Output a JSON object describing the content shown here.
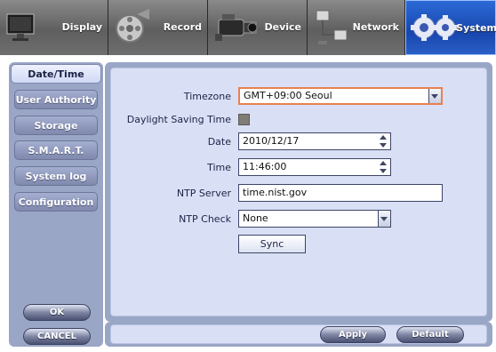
{
  "tabs": [
    {
      "label": "Display",
      "icon": "monitor-icon"
    },
    {
      "label": "Record",
      "icon": "film-reel-icon"
    },
    {
      "label": "Device",
      "icon": "camcorder-icon"
    },
    {
      "label": "Network",
      "icon": "network-icon"
    },
    {
      "label": "System",
      "icon": "gears-icon",
      "active": true
    }
  ],
  "sidebar": {
    "items": [
      {
        "label": "Date/Time",
        "active": true
      },
      {
        "label": "User Authority"
      },
      {
        "label": "Storage"
      },
      {
        "label": "S.M.A.R.T."
      },
      {
        "label": "System log"
      },
      {
        "label": "Configuration"
      }
    ],
    "ok_label": "OK",
    "cancel_label": "CANCEL"
  },
  "form": {
    "timezone": {
      "label": "Timezone",
      "value": "GMT+09:00 Seoul"
    },
    "dst": {
      "label": "Daylight Saving Time",
      "checked": false
    },
    "date": {
      "label": "Date",
      "value": "2010/12/17"
    },
    "time": {
      "label": "Time",
      "value": "11:46:00"
    },
    "ntp_server": {
      "label": "NTP Server",
      "value": "time.nist.gov"
    },
    "ntp_check": {
      "label": "NTP Check",
      "value": "None"
    },
    "sync_label": "Sync"
  },
  "footer": {
    "apply_label": "Apply",
    "default_label": "Default"
  },
  "colors": {
    "accent": "#1746ad",
    "panel": "#d9e0f6",
    "frame": "#9aa6c6",
    "focus_border": "#e8814f"
  }
}
